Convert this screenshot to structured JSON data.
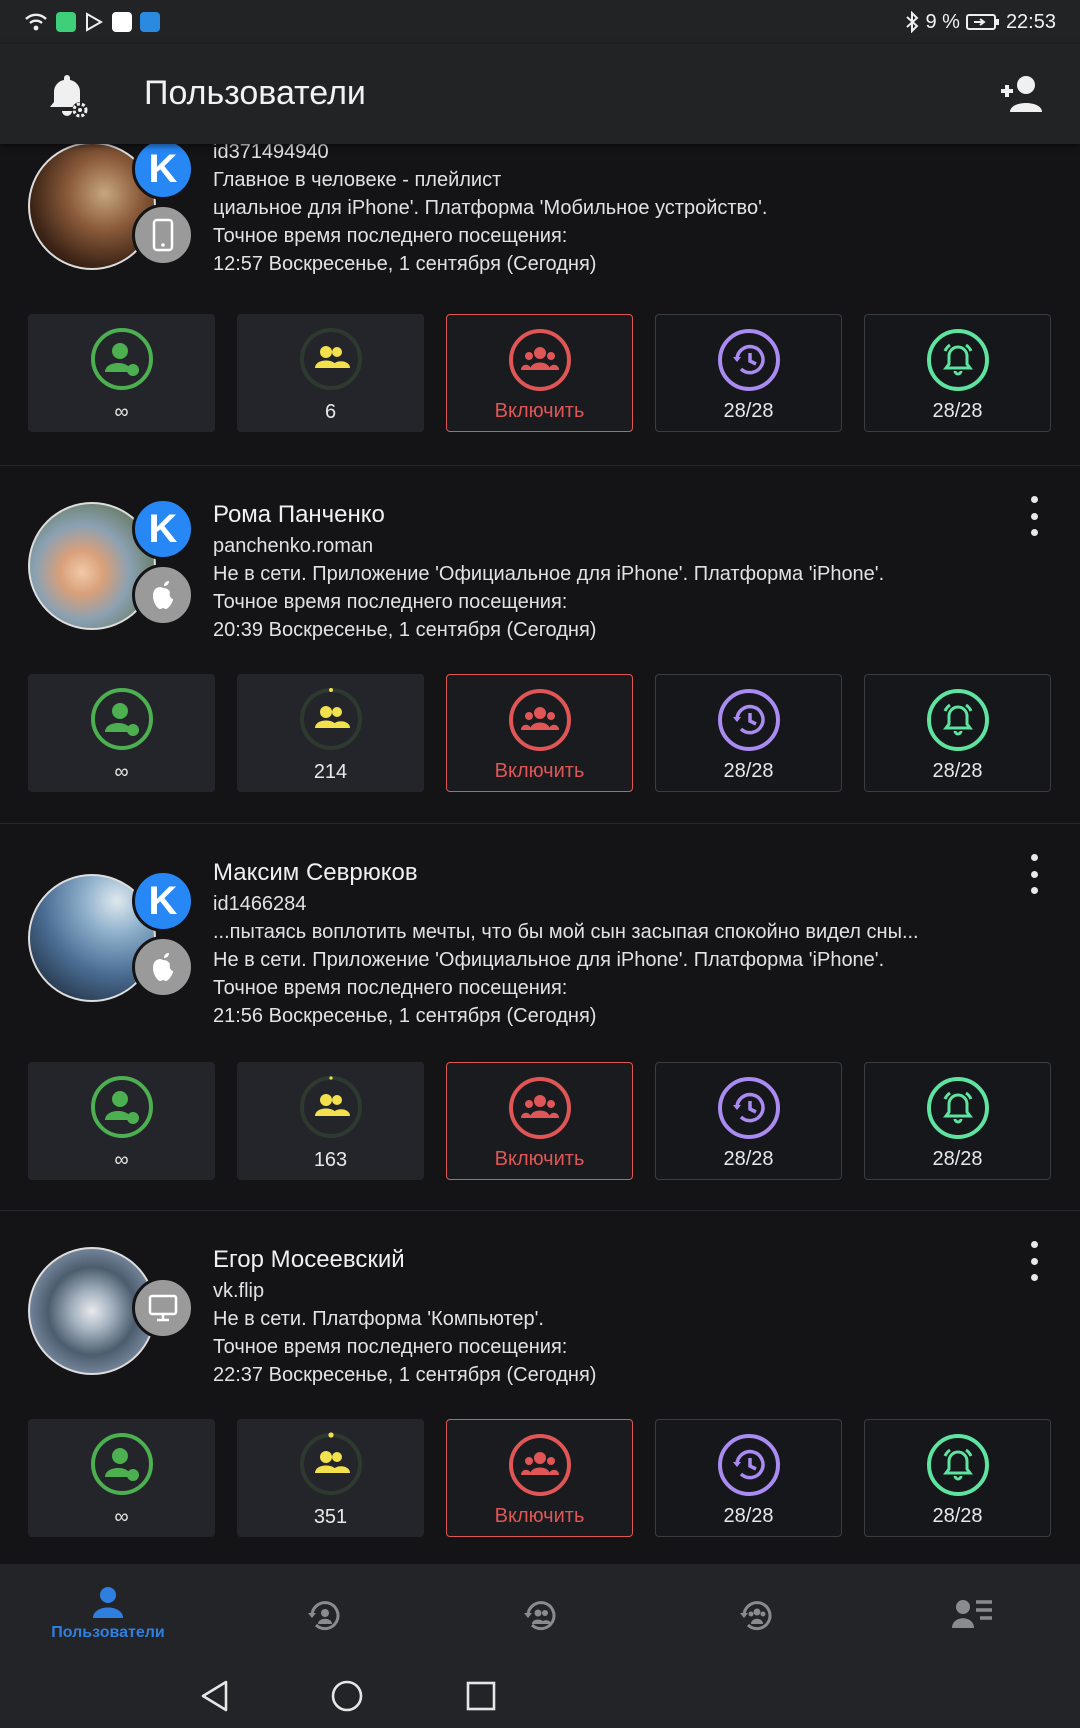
{
  "status_bar": {
    "battery": "9 %",
    "time": "22:53"
  },
  "app_bar": {
    "title": "Пользователи"
  },
  "users": [
    {
      "name": "",
      "id": "id371494940",
      "lines": [
        "Главное в человеке - плейлист",
        "циальное для iPhone'. Платформа 'Мобильное устройство'.",
        "Точное время последнего посещения:",
        "12:57 Воскресенье, 1 сентября (Сегодня)"
      ],
      "tiles": [
        "∞",
        "6",
        "Включить",
        "28/28",
        "28/28"
      ]
    },
    {
      "name": "Рома Панченко",
      "id": "panchenko.roman",
      "lines": [
        "Не в сети. Приложение 'Официальное для iPhone'. Платформа 'iPhone'.",
        "Точное время последнего посещения:",
        "20:39 Воскресенье, 1 сентября (Сегодня)"
      ],
      "tiles": [
        "∞",
        "214",
        "Включить",
        "28/28",
        "28/28"
      ]
    },
    {
      "name": "Максим Севрюков",
      "id": "id1466284",
      "lines": [
        "...пытаясь воплотить мечты, что бы мой сын засыпая спокойно видел сны...",
        "Не в сети. Приложение 'Официальное для iPhone'. Платформа 'iPhone'.",
        "Точное время последнего посещения:",
        "21:56 Воскресенье, 1 сентября (Сегодня)"
      ],
      "tiles": [
        "∞",
        "163",
        "Включить",
        "28/28",
        "28/28"
      ]
    },
    {
      "name": "Егор Мосеевский",
      "id": "vk.flip",
      "lines": [
        "Не в сети. Платформа 'Компьютер'.",
        "Точное время последнего посещения:",
        "22:37 Воскресенье, 1 сентября (Сегодня)"
      ],
      "tiles": [
        "∞",
        "351",
        "Включить",
        "28/28",
        "28/28"
      ]
    }
  ],
  "bottom_nav": {
    "active_label": "Пользователи"
  },
  "colors": {
    "green": "#4caf50",
    "yellow": "#f2e14c",
    "red": "#e05656",
    "purple": "#a98bf2",
    "mint": "#5ee3a0",
    "blue": "#2f7fe0"
  },
  "icons": [
    "bell-settings-icon",
    "add-user-icon",
    "vk-icon",
    "phone-icon",
    "apple-icon",
    "computer-icon",
    "user-online-icon",
    "friends-icon",
    "group-icon",
    "history-icon",
    "alarm-icon"
  ]
}
